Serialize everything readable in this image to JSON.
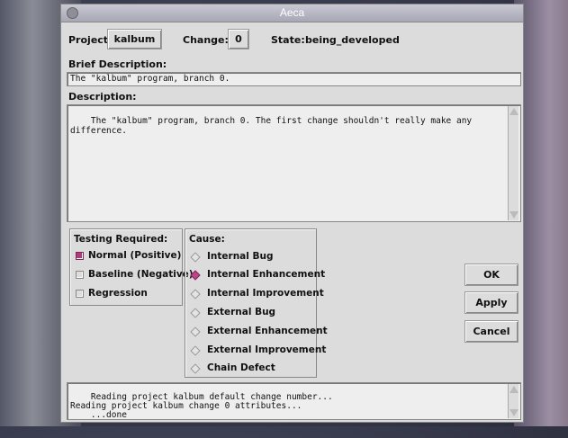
{
  "window": {
    "title": "Aeca"
  },
  "header": {
    "project_label": "Project:",
    "project_value": "kalbum",
    "change_label": "Change:",
    "change_value": "0",
    "state_label": "State:",
    "state_value": "being_developed"
  },
  "brief": {
    "label": "Brief Description:",
    "value": "The \"kalbum\" program, branch 0."
  },
  "description": {
    "label": "Description:",
    "value": "The \"kalbum\" program, branch 0. The first change shouldn't really make any\ndifference."
  },
  "testing": {
    "label": "Testing Required:",
    "items": [
      {
        "label": "Normal (Positive)",
        "checked": true
      },
      {
        "label": "Baseline (Negative)",
        "checked": false
      },
      {
        "label": "Regression",
        "checked": false
      }
    ]
  },
  "cause": {
    "label": "Cause:",
    "options": [
      {
        "label": "Internal Bug",
        "selected": false
      },
      {
        "label": "Internal Enhancement",
        "selected": true
      },
      {
        "label": "Internal Improvement",
        "selected": false
      },
      {
        "label": "External Bug",
        "selected": false
      },
      {
        "label": "External Enhancement",
        "selected": false
      },
      {
        "label": "External Improvement",
        "selected": false
      },
      {
        "label": "Chain Defect",
        "selected": false
      }
    ]
  },
  "buttons": {
    "ok": "OK",
    "apply": "Apply",
    "cancel": "Cancel"
  },
  "log": {
    "text": "Reading project kalbum default change number...\nReading project kalbum change 0 attributes...\n    ...done"
  },
  "colors": {
    "accent": "#c04488",
    "titlebar": "#a7a7b5"
  }
}
